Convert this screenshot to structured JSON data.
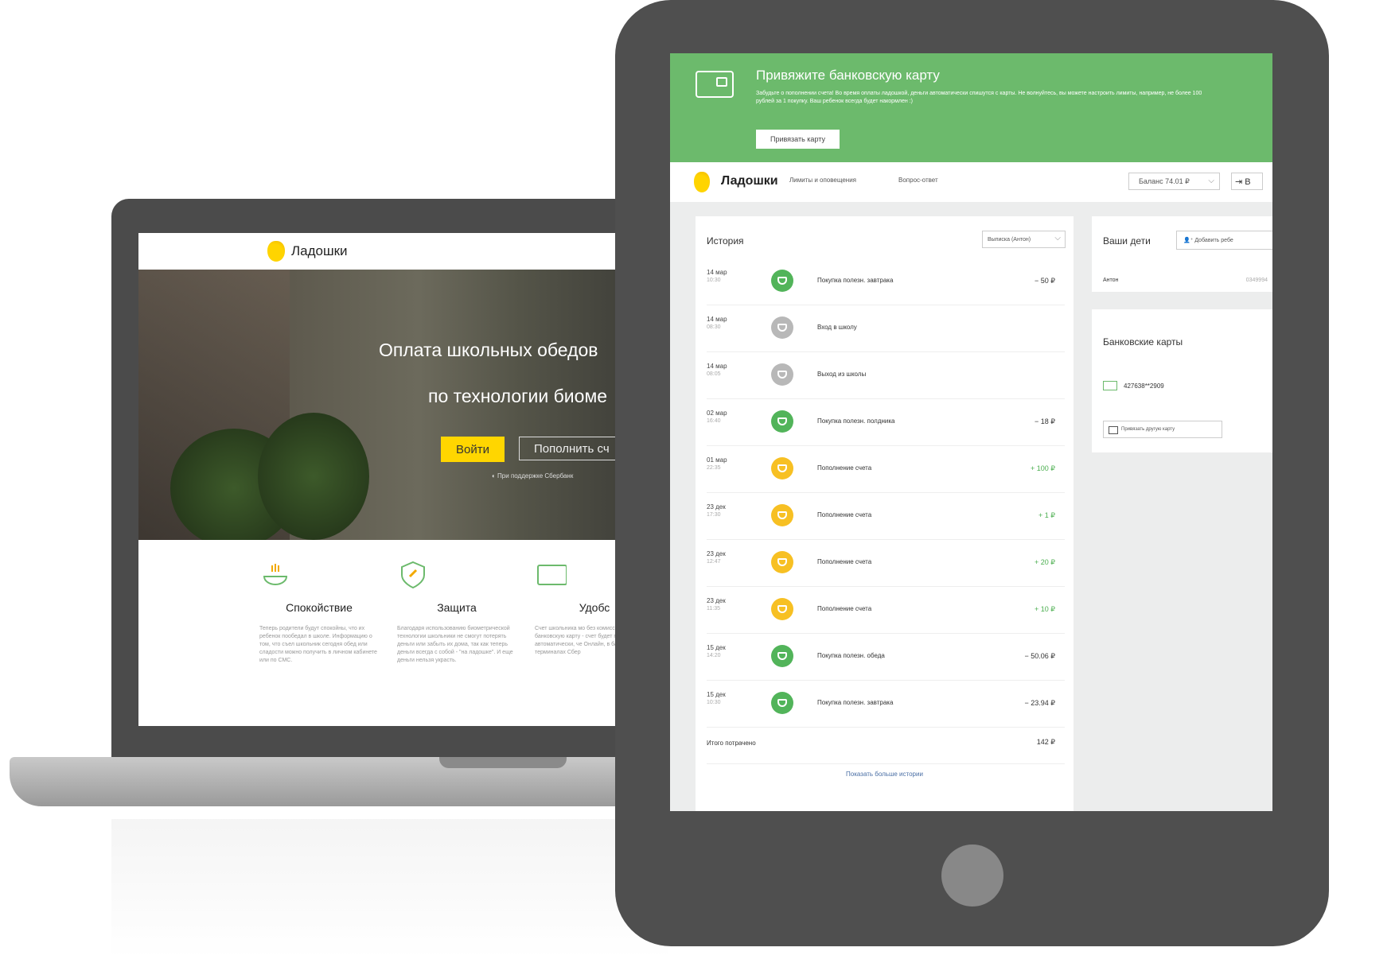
{
  "laptop": {
    "logo": "Ладошки",
    "hero_title": "Оплата школьных обедов",
    "hero_subtitle": "по технологии биоме",
    "login_button": "Войти",
    "topup_button": "Пополнить сч",
    "sber_note": "◐ При поддержке Сбербанк",
    "features": [
      {
        "title": "Спокойствие",
        "text": "Теперь родители будут спокойны, что их ребенок пообедал в школе. Информацию о том, что съел школьник сегодня обед или сладости можно получить в личном кабинете или по СМС."
      },
      {
        "title": "Защита",
        "text": "Благодаря использованию биометрической технологии школьники не смогут потерять деньги или забыть их дома, так как теперь деньги всегда с собой - \"на ладошке\". И еще деньги нельзя украсть."
      },
      {
        "title": "Удобс",
        "text": "Счет школьника мо без комиссии: \"пре банковскую карту - счет будет попол автоматически, че Онлайн, в банкома и терминалах Сбер"
      }
    ]
  },
  "tablet": {
    "banner": {
      "title": "Привяжите банковскую карту",
      "text": "Забудьте о пополнении счета! Во время оплаты ладошкой, деньги автоматически спишутся с карты. Не волнуйтесь, вы можете настроить лимиты, например, не более 100 рублей за 1 покупку. Ваш ребенок всегда будет накормлен :)",
      "button": "Привязать карту"
    },
    "nav": {
      "logo": "Ладошки",
      "link1": "Лимиты и оповещения",
      "link2": "Вопрос-ответ",
      "balance": "Баланс 74.01 ₽",
      "exit": "⇥ В"
    },
    "history": {
      "title": "История",
      "filter": "Выписка (Антон)",
      "rows": [
        {
          "date": "14 мар",
          "time": "10:30",
          "label": "Покупка полезн. завтрака",
          "amount": "− 50 ₽",
          "type": "green"
        },
        {
          "date": "14 мар",
          "time": "08:30",
          "label": "Вход в школу",
          "amount": "",
          "type": "grey"
        },
        {
          "date": "14 мар",
          "time": "08:05",
          "label": "Выход из школы",
          "amount": "",
          "type": "grey"
        },
        {
          "date": "02 мар",
          "time": "16:40",
          "label": "Покупка полезн. полдника",
          "amount": "− 18 ₽",
          "type": "green"
        },
        {
          "date": "01 мар",
          "time": "22:35",
          "label": "Пополнение счета",
          "amount": "+ 100 ₽",
          "type": "yellow"
        },
        {
          "date": "23 дек",
          "time": "17:30",
          "label": "Пополнение счета",
          "amount": "+ 1 ₽",
          "type": "yellow"
        },
        {
          "date": "23 дек",
          "time": "12:47",
          "label": "Пополнение счета",
          "amount": "+ 20 ₽",
          "type": "yellow"
        },
        {
          "date": "23 дек",
          "time": "11:35",
          "label": "Пополнение счета",
          "amount": "+ 10 ₽",
          "type": "yellow"
        },
        {
          "date": "15 дек",
          "time": "14:20",
          "label": "Покупка полезн. обеда",
          "amount": "− 50.06 ₽",
          "type": "green"
        },
        {
          "date": "15 дек",
          "time": "10:30",
          "label": "Покупка полезн. завтрака",
          "amount": "− 23.94 ₽",
          "type": "green"
        }
      ],
      "total_label": "Итого потрачено",
      "total_value": "142 ₽",
      "more": "Показать больше истории"
    },
    "kids": {
      "title": "Ваши дети",
      "add_button": "Добавить ребе",
      "child_name": "Антон",
      "child_id": "0349994"
    },
    "cards": {
      "title": "Банковские карты",
      "card_number": "427638**2909",
      "add_card": "Привязать другую карту"
    }
  }
}
